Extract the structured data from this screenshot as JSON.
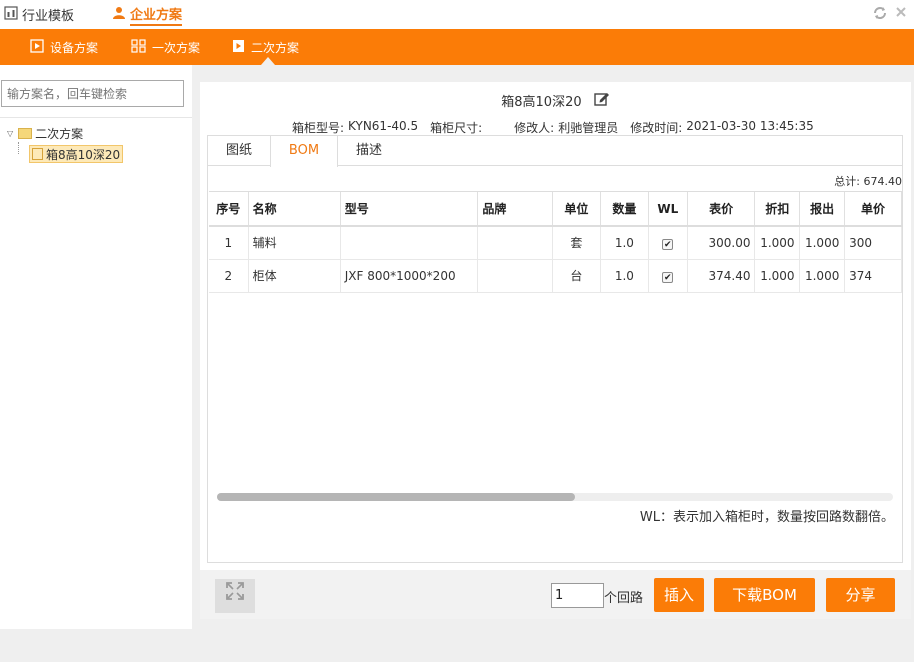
{
  "topbar": {
    "tabs": [
      {
        "label": "行业模板"
      },
      {
        "label": "企业方案"
      }
    ]
  },
  "navbar": {
    "items": [
      {
        "label": "设备方案"
      },
      {
        "label": "一次方案"
      },
      {
        "label": "二次方案"
      }
    ]
  },
  "sidebar": {
    "search_placeholder": "输方案名，回车键检索",
    "tree": {
      "root": "二次方案",
      "child": "箱8高10深20"
    }
  },
  "scheme": {
    "title": "箱8高10深20",
    "meta": {
      "cabinet_model_label": "箱柜型号:",
      "cabinet_model": "KYN61-40.5",
      "cabinet_size_label": "箱柜尺寸:",
      "cabinet_size": "",
      "modifier_label": "修改人:",
      "modifier": "利驰管理员",
      "modified_time_label": "修改时间:",
      "modified_time": "2021-03-30 13:45:35"
    }
  },
  "tabs": [
    {
      "label": "图纸"
    },
    {
      "label": "BOM"
    },
    {
      "label": "描述"
    }
  ],
  "bom": {
    "total": "总计: 674.40",
    "columns": [
      "序号",
      "名称",
      "型号",
      "品牌",
      "单位",
      "数量",
      "WL",
      "表价",
      "折扣",
      "报出",
      "单价"
    ],
    "rows": [
      {
        "no": "1",
        "name": "辅料",
        "model": "",
        "brand": "",
        "unit": "套",
        "qty": "1.0",
        "wl": true,
        "list_price": "300.00",
        "discount": "1.000",
        "quote": "1.000",
        "unit_price": "300"
      },
      {
        "no": "2",
        "name": "柜体",
        "model": "JXF 800*1000*200",
        "brand": "",
        "unit": "台",
        "qty": "1.0",
        "wl": true,
        "list_price": "374.40",
        "discount": "1.000",
        "quote": "1.000",
        "unit_price": "374"
      }
    ],
    "scroll_fraction": 0.53,
    "wl_note": "WL：表示加入箱柜时，数量按回路数翻倍。"
  },
  "bottom": {
    "loop_count": "1",
    "loop_label": "个回路",
    "insert_label": "插入",
    "download_label": "下载BOM",
    "share_label": "分享"
  }
}
